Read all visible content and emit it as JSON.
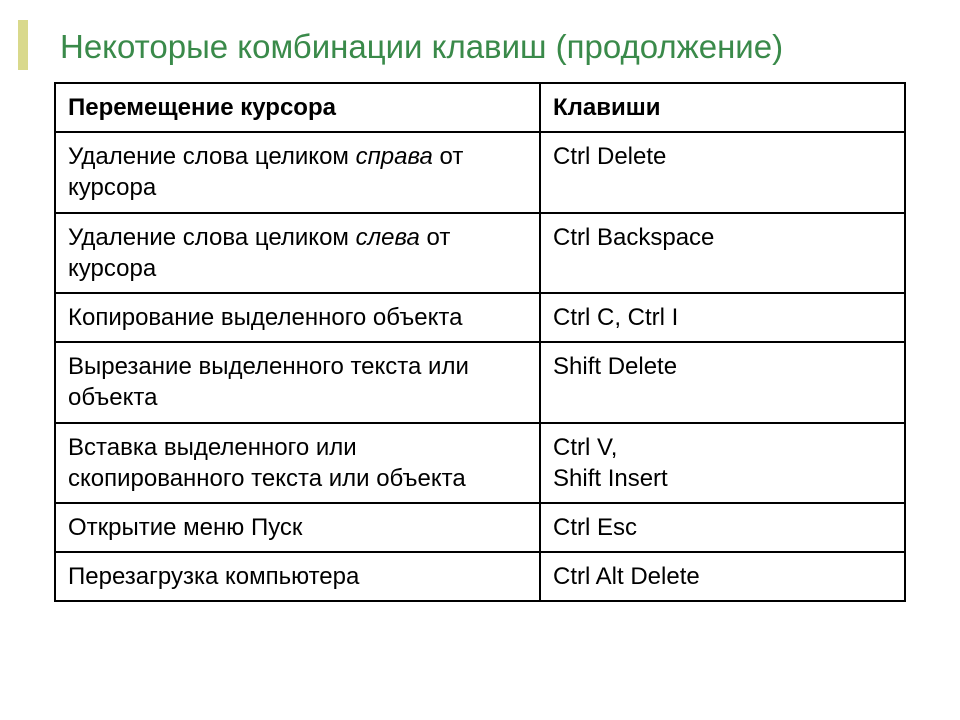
{
  "title": "Некоторые комбинации клавиш (продолжение)",
  "headers": {
    "action": "Перемещение курсора",
    "keys": "Клавиши"
  },
  "rows": [
    {
      "action_pre": "Удаление слова целиком ",
      "action_italic": "справа",
      "action_post": " от курсора",
      "keys": "Ctrl   Delete"
    },
    {
      "action_pre": "Удаление слова целиком ",
      "action_italic": "слева",
      "action_post": " от курсора",
      "keys": "Ctrl   Backspace"
    },
    {
      "action_pre": "Копирование выделенного объекта",
      "action_italic": "",
      "action_post": "",
      "keys": "Ctrl  C,    Ctrl  I"
    },
    {
      "action_pre": "Вырезание выделенного текста или объекта",
      "action_italic": "",
      "action_post": "",
      "keys": "Shift  Delete"
    },
    {
      "action_pre": "Вставка выделенного или скопированного текста или объекта",
      "action_italic": "",
      "action_post": "",
      "keys": "Ctrl  V,\nShift  Insert"
    },
    {
      "action_pre": "Открытие меню Пуск",
      "action_italic": "",
      "action_post": "",
      "keys": "Ctrl  Esc"
    },
    {
      "action_pre": "Перезагрузка компьютера",
      "action_italic": "",
      "action_post": "",
      "keys": "Ctrl Alt Delete"
    }
  ]
}
